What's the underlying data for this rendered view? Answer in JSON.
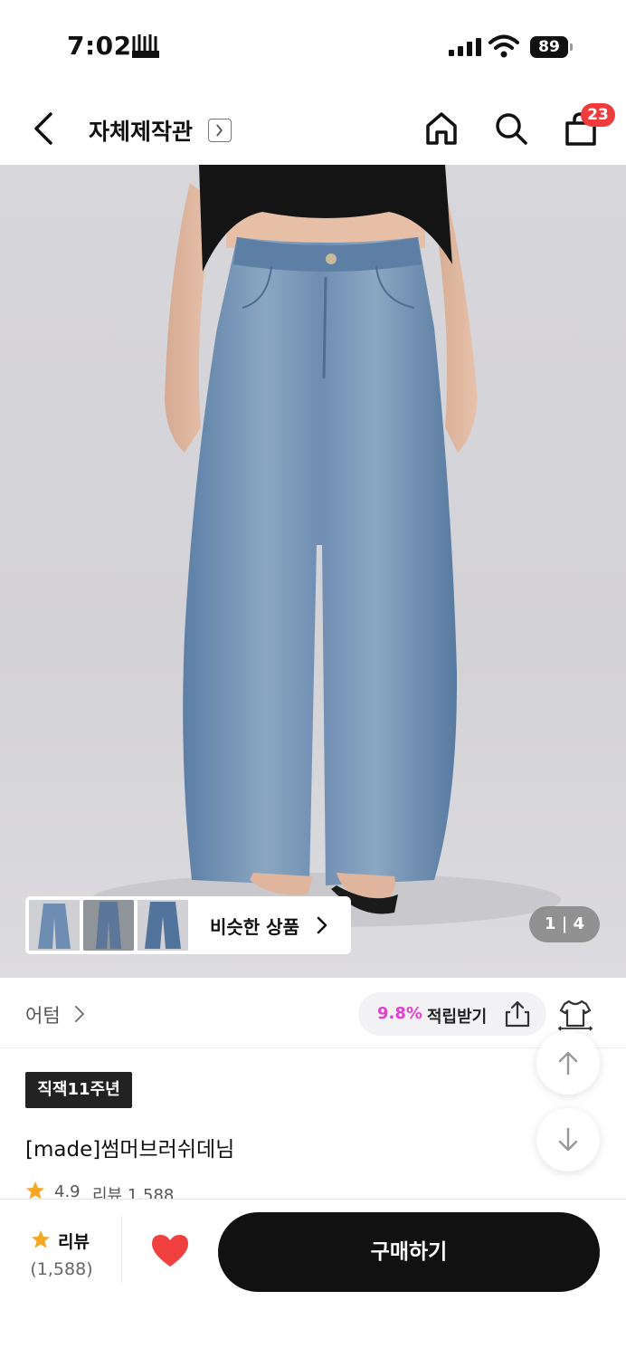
{
  "status_bar": {
    "time": "7:02",
    "battery": "89"
  },
  "header": {
    "store_title": "자체제작관",
    "cart_count": "23",
    "icons": [
      "back-icon",
      "chevron-right-icon",
      "home-icon",
      "search-icon",
      "shopping-bag-icon"
    ]
  },
  "gallery": {
    "similar_label": "비슷한 상품",
    "page_current": "1",
    "page_total": "4",
    "page_text": "1 | 4"
  },
  "brand": {
    "name": "어텀",
    "points_rate": "9.8%",
    "points_label": "적립받기"
  },
  "product": {
    "tag": "직잭11주년",
    "name": "[made]썸머브러쉬데님",
    "rating": "4.9",
    "reviews_text": "리뷰 1,588"
  },
  "bottom_bar": {
    "review_label": "리뷰",
    "review_count": "(1,588)",
    "buy_label": "구매하기"
  },
  "colors": {
    "accent_pink": "#e03fd0",
    "badge_red": "#ef3b3b",
    "heart_red": "#f04040",
    "star_orange": "#f5a623",
    "button_black": "#111111"
  }
}
